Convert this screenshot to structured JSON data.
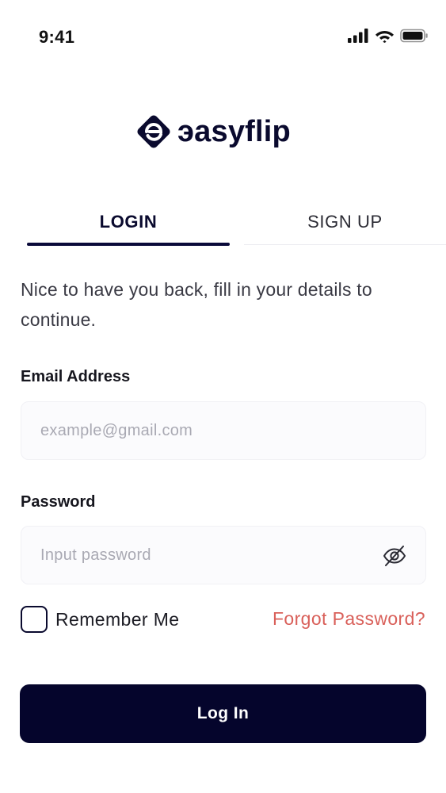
{
  "status_bar": {
    "time": "9:41"
  },
  "logo": {
    "mark_icon": "easyflip-diamond-e-icon",
    "text": "эasyflip"
  },
  "tabs": [
    {
      "label": "LOGIN",
      "active": true
    },
    {
      "label": "SIGN UP",
      "active": false
    }
  ],
  "intro_text": "Nice to have you back, fill in your details to continue.",
  "email": {
    "label": "Email Address",
    "placeholder": "example@gmail.com",
    "value": ""
  },
  "password": {
    "label": "Password",
    "placeholder": "Input password",
    "value": "",
    "toggle_icon": "eye-off-icon"
  },
  "remember_me": {
    "label": "Remember Me",
    "checked": false
  },
  "forgot_password": {
    "label": "Forgot Password?"
  },
  "submit": {
    "label": "Log In"
  },
  "colors": {
    "primary": "#05052C",
    "link": "#D9605A",
    "input_bg": "#FBFBFD"
  }
}
